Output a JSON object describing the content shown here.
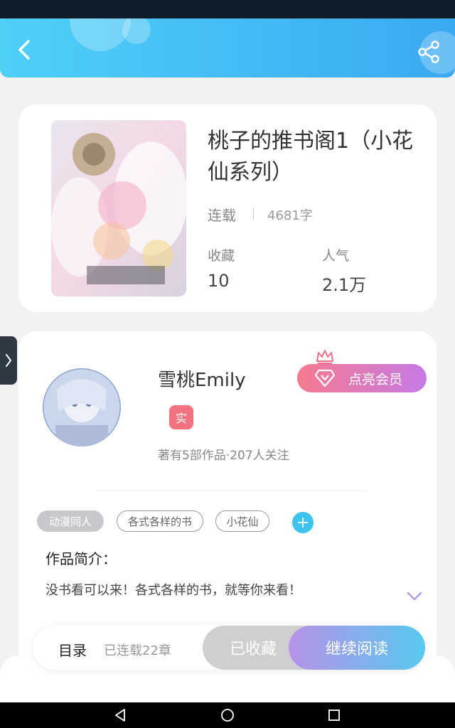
{
  "book": {
    "title": "桃子的推书阁1（小花仙系列）",
    "status": "连载",
    "word_count": "4681字",
    "favorites_label": "收藏",
    "favorites_value": "10",
    "popularity_label": "人气",
    "popularity_value": "2.1万"
  },
  "author": {
    "name": "雪桃Emily",
    "verified_label": "实",
    "stats": "著有5部作品·207人关注",
    "vip_label": "点亮会员"
  },
  "tags": [
    "动漫同人",
    "各式各样的书",
    "小花仙"
  ],
  "intro": {
    "heading": "作品简介：",
    "text": "没书看可以来！各式各样的书，就等你来看！"
  },
  "action_bar": {
    "toc_label": "目录",
    "chapter_count": "已连载22章",
    "collected_label": "已收藏",
    "continue_label": "继续阅读"
  },
  "colors": {
    "header_start": "#4fd0f7",
    "header_end": "#3aa9f2",
    "vip_start": "#f57a8e",
    "vip_end": "#c67ae6",
    "continue_start": "#b792e8",
    "continue_end": "#57c9f0"
  },
  "icons": [
    "back-arrow-icon",
    "share-icon",
    "crown-icon",
    "diamond-icon",
    "plus-icon",
    "chevron-down-icon",
    "chevron-right-icon",
    "nav-back-icon",
    "nav-home-icon",
    "nav-recent-icon"
  ]
}
